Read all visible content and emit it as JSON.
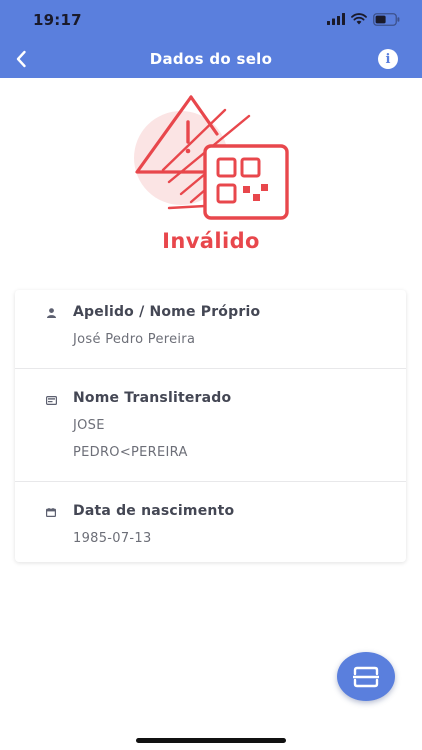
{
  "status_bar": {
    "time": "19:17",
    "signal_icon": "cellular-signal-icon",
    "wifi_icon": "wifi-icon",
    "battery_icon": "battery-icon"
  },
  "nav": {
    "title": "Dados do selo",
    "back_icon": "chevron-left-icon",
    "info_icon": "info-icon",
    "info_glyph": "i"
  },
  "verification": {
    "illustration": "warning-qr-code-illustration",
    "status": "Inválido",
    "status_color": "#e8474c"
  },
  "fields": [
    {
      "icon": "person-icon",
      "label": "Apelido / Nome Próprio",
      "lines": [
        "José Pedro Pereira"
      ]
    },
    {
      "icon": "id-card-icon",
      "label": "Nome Transliterado",
      "lines": [
        "JOSE",
        "PEDRO<PEREIRA"
      ]
    },
    {
      "icon": "calendar-icon",
      "label": "Data de nascimento",
      "lines": [
        "1985-07-13"
      ]
    }
  ],
  "fab": {
    "icon": "scan-icon"
  },
  "colors": {
    "primary": "#5a7fdd",
    "error": "#e8474c",
    "label": "#444754",
    "value": "#6d6f78"
  }
}
